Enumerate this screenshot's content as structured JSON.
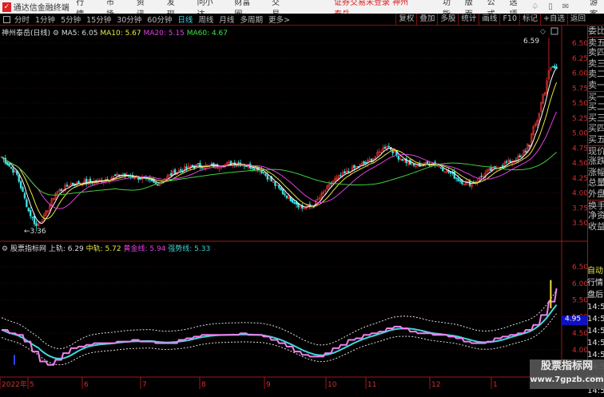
{
  "menubar": {
    "app_title": "通达信金融终端",
    "menus": [
      "行情",
      "市场",
      "资讯",
      "发现",
      "问小达",
      "财富圈",
      "交易"
    ],
    "login_alert": "证券交易未登录 神州泰岳",
    "right": [
      "功能",
      "版面",
      "公式",
      "选项"
    ],
    "user": "游客"
  },
  "toolbar": {
    "periods": [
      "分时",
      "1分钟",
      "5分钟",
      "15分钟",
      "30分钟",
      "60分钟",
      "日线",
      "周线",
      "月线",
      "多周期",
      "更多>"
    ],
    "active": "日线",
    "buttons": [
      "复权",
      "叠加",
      "多股",
      "统计",
      "画线",
      "F10",
      "标记",
      "+自选",
      "返回"
    ]
  },
  "main_info": {
    "name": "神州泰岳(日线)",
    "ma5": "MA5: 6.05",
    "ma10": "MA10: 5.67",
    "ma20": "MA20: 5.15",
    "ma60": "MA60: 4.67"
  },
  "sub_info": {
    "name": "股票指标网",
    "upper": "上轨: 6.29",
    "mid": "中轨: 5.72",
    "gold": "黄金线: 5.94",
    "strong": "强势线: 5.33"
  },
  "right_panel": {
    "labels": [
      "委比",
      "卖五",
      "卖四",
      "卖三",
      "卖二",
      "卖一",
      "买一",
      "买二",
      "买三",
      "买四",
      "买五",
      "现价",
      "涨跌",
      "涨幅",
      "总量",
      "外盘",
      "换手",
      "净资",
      "收益"
    ],
    "lower": [
      "自动",
      "行情",
      "盘后",
      "14:56",
      "14:56",
      "14:56",
      "14:56",
      "14:56",
      "14:56",
      "14:56",
      "14:57"
    ]
  },
  "watermark": {
    "line1": "股票指标网",
    "line2": "www.7gpzb.com"
  },
  "colors": {
    "up": "#e03030",
    "down": "#40e0e0",
    "ma5": "#ffffff",
    "ma10": "#e8e840",
    "ma20": "#e040e0",
    "ma60": "#40d040",
    "grid": "#a01818"
  },
  "chart_data": [
    {
      "type": "candlestick",
      "title": "神州泰岳(日线)",
      "y_ticks": [
        "6.50",
        "6.25",
        "6.00",
        "5.75",
        "5.50",
        "5.25",
        "5.00",
        "4.75",
        "4.50",
        "4.25",
        "4.00",
        "3.75",
        "3.50"
      ],
      "ylim": [
        3.4,
        6.65
      ],
      "x_ticks": [
        "2022年",
        "5",
        "6",
        "7",
        "8",
        "9",
        "10",
        "11",
        "12",
        "1"
      ],
      "key_closes": [
        [
          0,
          4.6
        ],
        [
          8,
          4.3
        ],
        [
          14,
          3.7
        ],
        [
          18,
          3.45
        ],
        [
          22,
          3.6
        ],
        [
          28,
          4.0
        ],
        [
          36,
          4.15
        ],
        [
          50,
          4.2
        ],
        [
          62,
          4.3
        ],
        [
          72,
          4.25
        ],
        [
          80,
          4.15
        ],
        [
          90,
          4.35
        ],
        [
          100,
          4.45
        ],
        [
          110,
          4.45
        ],
        [
          122,
          4.5
        ],
        [
          134,
          4.4
        ],
        [
          146,
          4.0
        ],
        [
          156,
          3.75
        ],
        [
          162,
          3.8
        ],
        [
          172,
          4.2
        ],
        [
          182,
          4.4
        ],
        [
          192,
          4.55
        ],
        [
          200,
          4.8
        ],
        [
          206,
          4.6
        ],
        [
          214,
          4.45
        ],
        [
          224,
          4.5
        ],
        [
          232,
          4.35
        ],
        [
          238,
          4.2
        ],
        [
          244,
          4.15
        ],
        [
          252,
          4.35
        ],
        [
          262,
          4.5
        ],
        [
          270,
          4.6
        ],
        [
          276,
          5.0
        ],
        [
          280,
          5.5
        ],
        [
          283,
          5.9
        ],
        [
          286,
          6.1
        ],
        [
          288,
          6.05
        ]
      ],
      "annotations": [
        "6.59",
        "3.36"
      ]
    },
    {
      "type": "line",
      "title": "股票指标网",
      "y_ticks": [
        "6.50",
        "6.00",
        "5.50",
        "5.00",
        "4.50",
        "4.00"
      ],
      "current_value": "4.95",
      "series": [
        "上轨",
        "中轨",
        "黄金线",
        "强势线"
      ]
    }
  ]
}
